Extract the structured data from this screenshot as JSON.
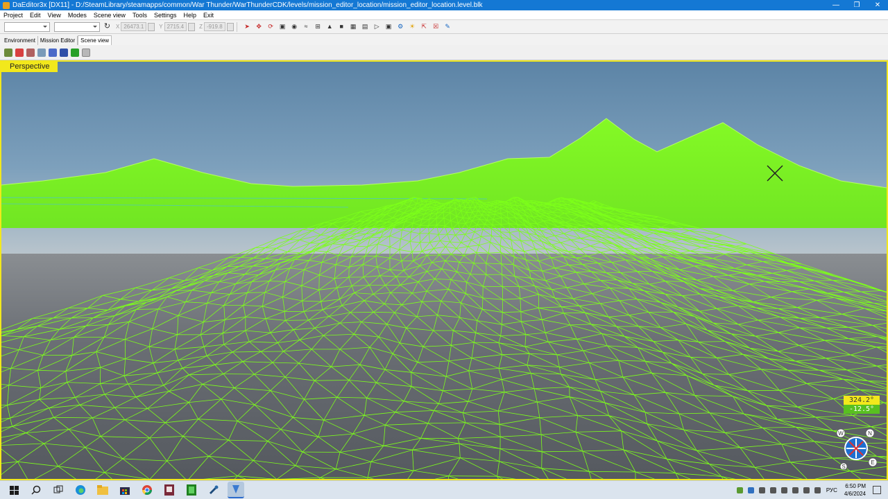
{
  "window": {
    "title": "DaEditor3x  [DX11]  - D:/SteamLibrary/steamapps/common/War Thunder/WarThunderCDK/levels/mission_editor_location/mission_editor_location.level.blk",
    "controls": [
      "minimize",
      "restore",
      "close"
    ]
  },
  "menubar": {
    "items": [
      "Project",
      "Edit",
      "View",
      "Modes",
      "Scene view",
      "Tools",
      "Settings",
      "Help",
      "Exit"
    ]
  },
  "toolbar": {
    "x_label": "X",
    "x_value": "26473.1",
    "y_label": "Y",
    "y_value": "2715.4",
    "z_label": "Z",
    "z_value": "-919.8"
  },
  "tabs": [
    "Environment",
    "Mission Editor",
    "Scene view"
  ],
  "viewport": {
    "label": "Perspective",
    "hud_azimuth": "324.2°",
    "hud_elevation": "-12.5°",
    "compass": {
      "north": "N",
      "west": "W",
      "east": "E",
      "south": "S"
    },
    "colors": {
      "frame": "#f2e81c",
      "wireframe": "#7dff1a"
    }
  },
  "taskbar": {
    "apps": [
      "start-icon",
      "search-icon",
      "task-view-icon",
      "edge-icon",
      "file-explorer-icon",
      "store-icon",
      "chrome-icon",
      "app-icon",
      "app-icon",
      "steam-icon",
      "daeditor-icon"
    ],
    "language": "РУС",
    "time": "6:50 PM",
    "date": "4/6/2024"
  }
}
